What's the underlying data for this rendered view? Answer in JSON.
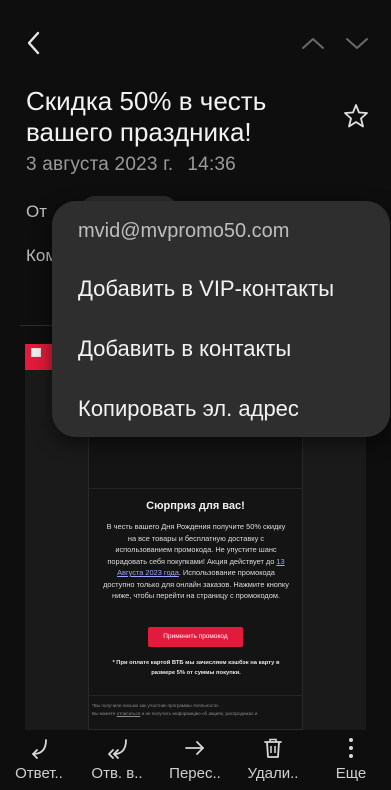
{
  "header": {
    "icons": {
      "back": "chevron-left-icon",
      "prev": "chevron-up-icon",
      "next": "chevron-down-icon"
    }
  },
  "message": {
    "subject": "Скидка 50% в честь вашего праздника!",
    "date": "3 августа 2023 г.",
    "time": "14:36",
    "from_label": "От",
    "to_label": "Кому",
    "star_icon": "star-outline-icon"
  },
  "popup": {
    "email": "mvid@mvpromo50.com",
    "items": [
      {
        "label": "Добавить в VIP-контакты"
      },
      {
        "label": "Добавить в контакты"
      },
      {
        "label": "Копировать эл. адрес"
      }
    ]
  },
  "email_body": {
    "title": "Сюрприз для вас!",
    "text_part1": "В честь вашего Дня Рождения получите 50% скидку на все товары и бесплатную доставку с использованием промокода. Не упустите шанс порадовать себя покупками! Акция действует до ",
    "text_link": "13 Августа 2023 года",
    "text_part2": ". Использование промокода доступно только для онлайн заказов. Нажмите кнопку ниже, чтобы перейти на страницу с промокодом.",
    "button": "Применить промокод",
    "note": "* При оплате картой ВТБ мы зачисляем кэшбэк на карту в размере 5% от суммы покупки.",
    "footer_line1": "*Вы получили письмо как участник программы лояльности.",
    "footer_line2_a": "Вы можете ",
    "footer_line2_link": "отписаться",
    "footer_line2_b": " и не получать информацию об акциях, распродажах и"
  },
  "bottom_bar": {
    "items": [
      {
        "label": "Ответ..",
        "icon": "reply-icon"
      },
      {
        "label": "Отв. в..",
        "icon": "reply-all-icon"
      },
      {
        "label": "Перес..",
        "icon": "forward-icon"
      },
      {
        "label": "Удали..",
        "icon": "trash-icon"
      },
      {
        "label": "Еще",
        "icon": "more-vertical-icon"
      }
    ]
  },
  "colors": {
    "accent_red": "#e21a3b",
    "background": "#0e0e0e",
    "popup_bg": "#2e2e2e"
  }
}
